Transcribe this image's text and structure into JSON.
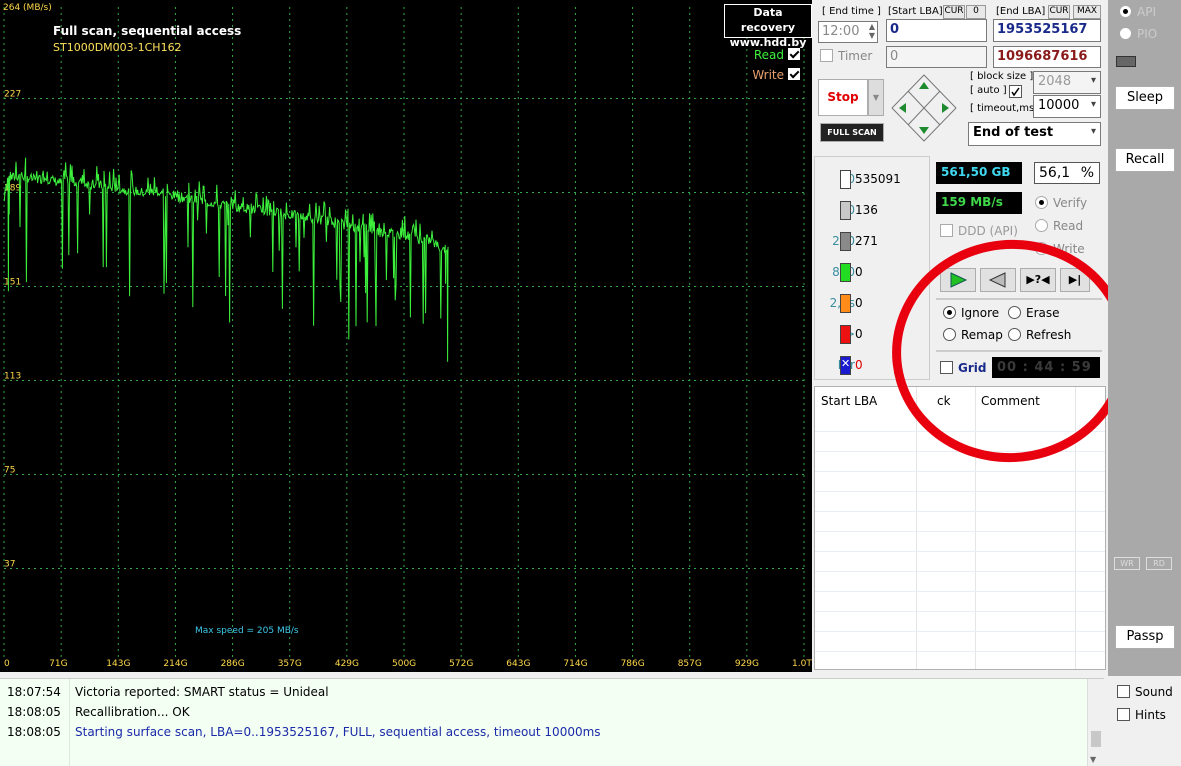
{
  "graph": {
    "unit": "264 (MB/s)",
    "title": "Full scan, sequential access",
    "drive_model": "ST1000DM003-1CH162",
    "brand_line1": "Data recovery",
    "brand_line2": "www.hdd.by",
    "legend_read": "Read",
    "legend_write": "Write",
    "max_speed_text": "Max speed = 205 MB/s",
    "y_ticks": [
      "227",
      "189",
      "151",
      "113",
      "75",
      "37"
    ],
    "x_ticks": [
      "0",
      "71G",
      "143G",
      "214G",
      "286G",
      "357G",
      "429G",
      "500G",
      "572G",
      "643G",
      "714G",
      "786G",
      "857G",
      "929G",
      "1.0T"
    ],
    "colors": {
      "background": "#000000",
      "grid": "#2fa84a",
      "read_line": "#3cf03c",
      "labels": "#ffd84a"
    }
  },
  "chart_data": {
    "type": "line",
    "title": "Full scan, sequential access",
    "xlabel": "",
    "ylabel": "264 (MB/s)",
    "ylim": [
      0,
      264
    ],
    "xlim_gb": [
      0,
      1000
    ],
    "series": [
      {
        "name": "Read",
        "x": [
          0,
          5,
          10,
          20,
          30,
          40,
          50,
          60,
          70,
          80,
          90,
          100,
          110,
          120,
          130,
          140,
          150,
          160,
          170,
          180,
          190,
          200,
          210,
          220,
          230,
          240,
          250,
          260,
          270,
          280,
          290,
          300,
          310,
          320,
          330,
          340,
          350,
          360,
          370,
          380,
          390,
          400,
          410,
          420,
          430,
          440,
          450,
          460,
          470,
          480,
          490,
          500,
          510,
          520,
          530,
          540,
          550,
          555
        ],
        "y": [
          186,
          196,
          195,
          196,
          195,
          194,
          195,
          194,
          193,
          194,
          193,
          193,
          192,
          192,
          191,
          191,
          190,
          190,
          189,
          189,
          189,
          188,
          188,
          187,
          187,
          186,
          185,
          185,
          184,
          184,
          183,
          183,
          182,
          182,
          181,
          181,
          180,
          180,
          179,
          179,
          178,
          178,
          177,
          176,
          176,
          175,
          175,
          174,
          173,
          173,
          172,
          172,
          171,
          170,
          170,
          168,
          166,
          167
        ]
      }
    ]
  },
  "controls": {
    "end_time_label": "[ End time ]",
    "end_time_value": "12:00",
    "timer_label": "Timer",
    "timer_value": "0",
    "start_lba_label": "[Start LBA]",
    "cur_label": "CUR",
    "cur_value": "0",
    "start_lba_value": "0",
    "end_lba_label": "[End LBA]",
    "cur2_label": "CUR",
    "max_label": "MAX",
    "end_lba_value": "1953525167",
    "current_lba_value": "1096687616",
    "stop_label": "Stop",
    "full_scan_label": "FULL SCAN",
    "block_size_label": "[ block size ]",
    "auto_label": "[ auto ]",
    "block_size_value": "2048",
    "timeout_label": "[ timeout,ms ]",
    "timeout_value": "10000",
    "end_action_value": "End of test"
  },
  "counters": [
    {
      "label": "20",
      "value": "535091",
      "color": "#ffffff"
    },
    {
      "label": "80",
      "value": "136",
      "color": "#c8c8c8"
    },
    {
      "label": "200",
      "value": "271",
      "color": "#8a8a8a"
    },
    {
      "label": "800",
      "value": "0",
      "color": "#22dd22"
    },
    {
      "label": "2,4s",
      "value": "0",
      "color": "#ff8c1a"
    },
    {
      "label": ">",
      "value": "0",
      "color": "#ee1111"
    },
    {
      "label": "Err",
      "value": "0",
      "color": "#1a1ad0"
    }
  ],
  "stats": {
    "scanned": "561,50 GB",
    "percent": "56,1",
    "percent_sign": "%",
    "speed": "159 MB/s",
    "ddd_label": "DDD (API)",
    "verify_label": "Verify",
    "read_label": "Read",
    "write_label": "Write"
  },
  "actions": {
    "ignore_label": "Ignore",
    "erase_label": "Erase",
    "remap_label": "Remap",
    "refresh_label": "Refresh",
    "grid_label": "Grid",
    "elapsed": "00 : 44 : 59"
  },
  "table": {
    "col_start_lba": "Start LBA",
    "col_block": "ck",
    "col_comment": "Comment"
  },
  "side": {
    "api_label": "API",
    "pio_label": "PIO",
    "sleep_label": "Sleep",
    "recall_label": "Recall",
    "wr_label": "WR",
    "rd_label": "RD",
    "passp_label": "Passp",
    "sound_label": "Sound",
    "hints_label": "Hints"
  },
  "log": [
    {
      "time": "18:07:54",
      "message": "Victoria reported: SMART status = Unideal",
      "color": "#000000"
    },
    {
      "time": "18:08:05",
      "message": "Recallibration... OK",
      "color": "#000000"
    },
    {
      "time": "18:08:05",
      "message": "Starting surface scan, LBA=0..1953525167, FULL, sequential access, timeout 10000ms",
      "color": "#1a2aa8"
    }
  ]
}
